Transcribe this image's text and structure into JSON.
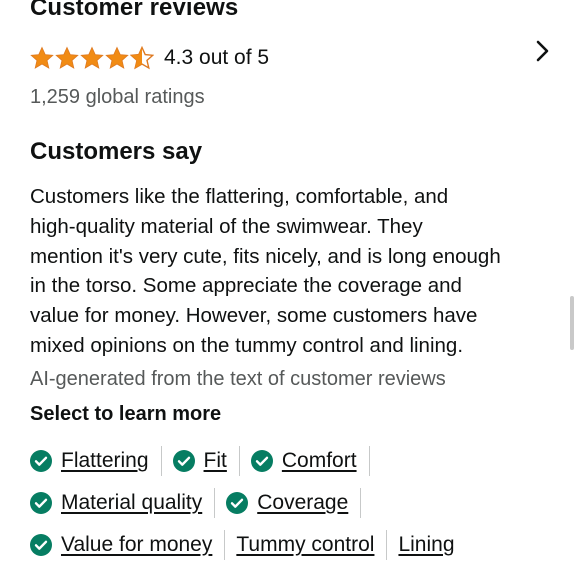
{
  "header": {
    "title": "Customer reviews",
    "rating": 4.3,
    "rating_text": "4.3 out of 5",
    "global_ratings": "1,259 global ratings"
  },
  "summary": {
    "title": "Customers say",
    "lines": [
      "Customers like the flattering, comfortable, and",
      "high-quality material of the swimwear. They",
      "mention it's very cute, fits nicely, and is long enough",
      "in the torso. Some appreciate the coverage and",
      "value for money. However, some customers have",
      "mixed opinions on the tummy control and lining."
    ],
    "ai_note": "AI-generated from the text of customer reviews"
  },
  "learn_more": {
    "title": "Select to learn more",
    "chips": [
      {
        "label": "Flattering",
        "positive": true
      },
      {
        "label": "Fit",
        "positive": true
      },
      {
        "label": "Comfort",
        "positive": true
      },
      {
        "label": "Material quality",
        "positive": true
      },
      {
        "label": "Coverage",
        "positive": true
      },
      {
        "label": "Value for money",
        "positive": true
      },
      {
        "label": "Tummy control",
        "positive": false
      },
      {
        "label": "Lining",
        "positive": false
      }
    ]
  },
  "colors": {
    "star": "#f18b14",
    "check": "#067d62",
    "text": "#0f1111",
    "muted": "#565959"
  }
}
